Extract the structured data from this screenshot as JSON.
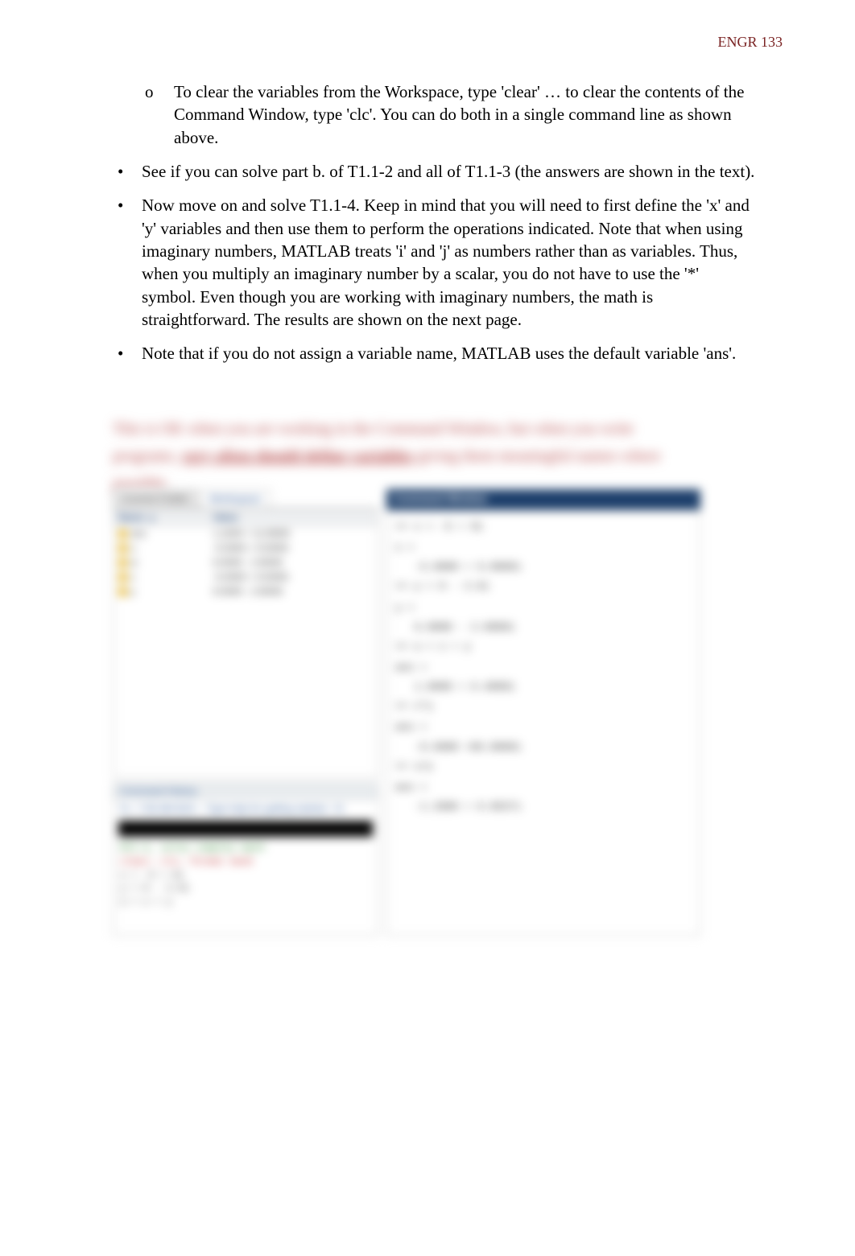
{
  "header": {
    "course": "ENGR 133"
  },
  "doc": {
    "sub_marker": "o",
    "bullet_marker": "•",
    "sub_item": "To clear the variables from the Workspace, type 'clear' … to clear the contents of the Command Window, type 'clc'.   You can do both in a single  command line as shown above.",
    "b2": "See if you can solve part b. of T1.1-2 and all of T1.1-3 (the answers are shown in the text).",
    "b3": "Now move on and solve T1.1-4.  Keep in mind that you will need to first define the 'x' and 'y' variables and then use them to perform  the operations indicated.  Note that when using imaginary numbers, MATLAB treats 'i' and 'j' as numbers rather than as variables.  Thus, when you multiply an imaginary number by a scalar, you do not have to use the '*' symbol.  Even though you are working with imaginary numbers, the math is straightforward.  The results are shown on the next page.",
    "b4": "Note that if you do not assign a variable name, MATLAB uses the default variable 'ans'. ",
    "blurred1": "This is OK when you are working in the Command Window, but when you write",
    "blurred2_pre": "programs, ",
    "blurred2_bold": "very often should define variables",
    "blurred2_post": " giving them meaningful names where",
    "blurred3": "possible."
  },
  "ui": {
    "tabs": {
      "current": "Current Folder",
      "workspace": "Workspace"
    },
    "cw_title": "Command Window",
    "ws": {
      "col_name": "Name ▲",
      "col_value": "Value",
      "rows": [
        {
          "name": "ans",
          "value": "1.2200 + 11.6500i"
        },
        {
          "name": "u",
          "value": "-5.0000 + 9.0000i"
        },
        {
          "name": "w",
          "value": "6.0000 - 2.6000i"
        },
        {
          "name": "x",
          "value": "-5.0000 + 9.0000i"
        },
        {
          "name": "y",
          "value": "6.0000 - 2.6000i"
        }
      ]
    },
    "cw_lines": [
      {
        "t": "prompt",
        "text": ">> x = -5 + 9i"
      },
      {
        "t": "var",
        "text": "x ="
      },
      {
        "t": "val",
        "text": "-5.0000 + 9.0000i"
      },
      {
        "t": "prompt",
        "text": ">> y = 6 - 2.6i"
      },
      {
        "t": "var",
        "text": "y ="
      },
      {
        "t": "val",
        "text": "6.0000 - 2.6000i"
      },
      {
        "t": "prompt",
        "text": ">> u = x + y"
      },
      {
        "t": "var",
        "text": "ans ="
      },
      {
        "t": "val",
        "text": "1.0000 + 6.4000i"
      },
      {
        "t": "prompt",
        "text": ">> x*y"
      },
      {
        "t": "var",
        "text": "ans ="
      },
      {
        "t": "val",
        "text": "-6.6000 +66.0000i"
      },
      {
        "t": "prompt",
        "text": ">> x/y"
      },
      {
        "t": "var",
        "text": "ans ="
      },
      {
        "t": "val",
        "text": "-1.2606 + 0.9537i"
      }
    ],
    "ch": {
      "title": "Command History",
      "msg": "%-- 7:45 AM 8/24 -- Type help for getting started --%",
      "lines": [
        {
          "cls": "green",
          "text": "%T1-4, solve complex math"
        },
        {
          "cls": "red",
          "text": "clear; clc; format bank"
        },
        {
          "cls": "",
          "text": "x = -5 + 9i"
        },
        {
          "cls": "",
          "text": "y = 6 - 2.6i"
        },
        {
          "cls": "",
          "text": "u = x + y"
        }
      ],
      "prompt": "fx"
    }
  }
}
